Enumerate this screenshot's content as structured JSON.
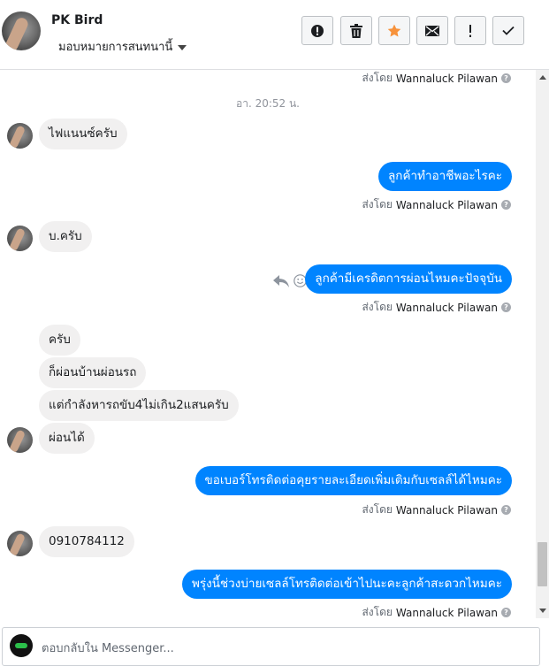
{
  "header": {
    "contact_name": "PK Bird",
    "assign_label": "มอบหมายการสนทนานี้",
    "toolbar": [
      {
        "name": "spam-button",
        "icon": "alert-circle-icon"
      },
      {
        "name": "delete-button",
        "icon": "trash-icon"
      },
      {
        "name": "star-button",
        "icon": "star-icon",
        "color": "#f7923b"
      },
      {
        "name": "mark-unread-button",
        "icon": "envelope-icon"
      },
      {
        "name": "flag-button",
        "icon": "exclamation-icon"
      },
      {
        "name": "done-button",
        "icon": "check-icon"
      }
    ]
  },
  "thread": {
    "sent_by_label": "ส่งโดย",
    "agent_name": "Wannaluck Pilawan",
    "help_icon": "?",
    "timestamp": "อา. 20:52 น.",
    "messages": [
      {
        "from": "customer",
        "text": "ไฟแนนซ์ครับ"
      },
      {
        "from": "page",
        "text": "ลูกค้าทำอาชีพอะไรคะ"
      },
      {
        "from": "customer",
        "text": "บ.ครับ"
      },
      {
        "from": "page",
        "text": "ลูกค้ามีเครดิตการผ่อนไหมคะปัจจุบัน"
      },
      {
        "from": "customer",
        "text": "ครับ"
      },
      {
        "from": "customer",
        "text": "ก็ผ่อนบ้านผ่อนรถ"
      },
      {
        "from": "customer",
        "text": "แต่กำลังหารถขับ4ไม่เกิน2แสนครับ"
      },
      {
        "from": "customer",
        "text": "ผ่อนได้"
      },
      {
        "from": "page",
        "text": "ขอเบอร์โทรติดต่อคุยรายละเอียดเพิ่มเติมกับเซลล์ได้ไหมคะ"
      },
      {
        "from": "customer",
        "text": "0910784112"
      },
      {
        "from": "page",
        "text": "พรุ่งนี้ช่วงบ่ายเซลล์โทรติดต่อเข้าไปนะคะลูกค้าสะดวกไหมคะ"
      }
    ]
  },
  "composer": {
    "placeholder": "ตอบกลับใน Messenger..."
  },
  "colors": {
    "outgoing_bubble": "#0084ff",
    "incoming_bubble": "#f1f0f0",
    "star": "#f7923b"
  }
}
